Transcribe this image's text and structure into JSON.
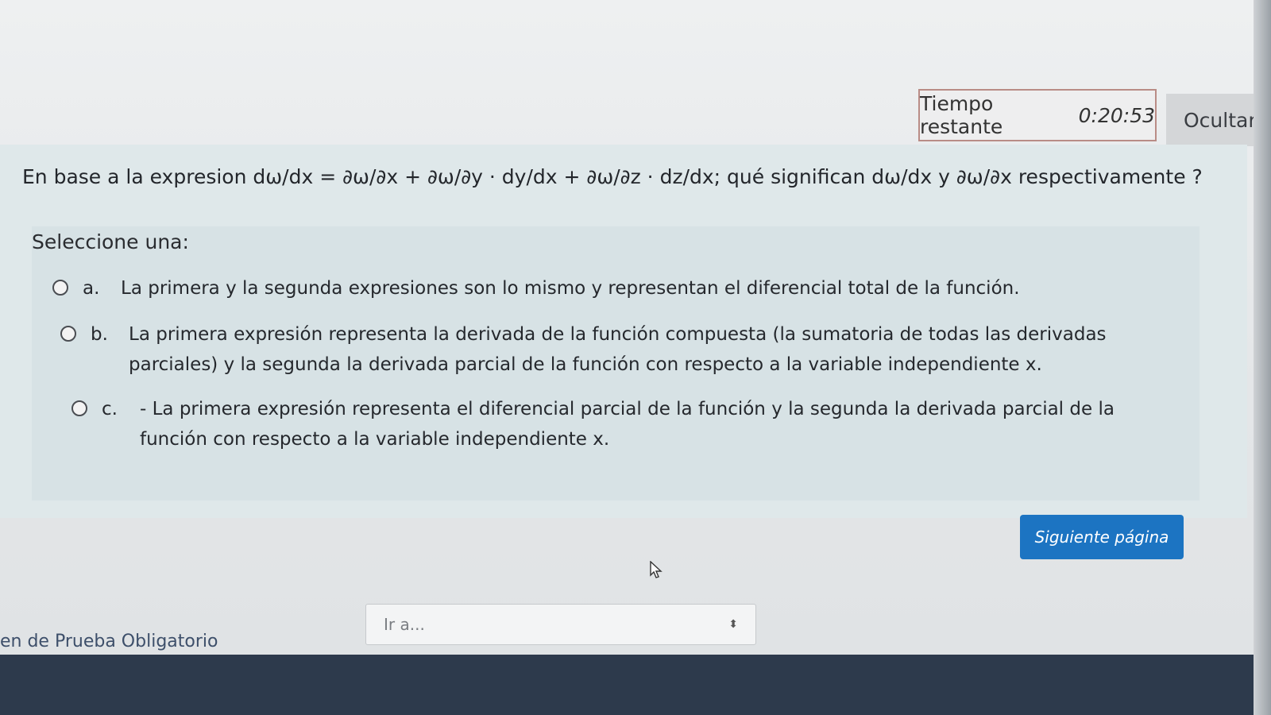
{
  "timer": {
    "label": "Tiempo restante",
    "value": "0:20:53",
    "hide_label": "Ocultar"
  },
  "question": {
    "text": "En base a la expresion dω/dx = ∂ω/∂x + ∂ω/∂y · dy/dx + ∂ω/∂z · dz/dx; qué significan dω/dx y ∂ω/∂x respectivamente ?",
    "prompt": "Seleccione una:",
    "options": [
      {
        "letter": "a.",
        "text": "La primera y la segunda expresiones son lo mismo y representan el diferencial total de la función."
      },
      {
        "letter": "b.",
        "text": "La primera expresión representa la derivada de la función compuesta (la sumatoria de todas las derivadas parciales) y la segunda la derivada parcial de la función con respecto a la variable independiente x."
      },
      {
        "letter": "c.",
        "text": "- La primera expresión representa el diferencial parcial de la función y la segunda la derivada parcial de la función con respecto a la variable independiente x."
      }
    ]
  },
  "navigation": {
    "next_label": "Siguiente página",
    "jump_placeholder": "Ir a...",
    "footer_label": "en de Prueba Obligatorio"
  },
  "colors": {
    "primary_button": "#1c74c2",
    "timer_border": "#b98c86",
    "footer_bar": "#2d3a4c"
  }
}
